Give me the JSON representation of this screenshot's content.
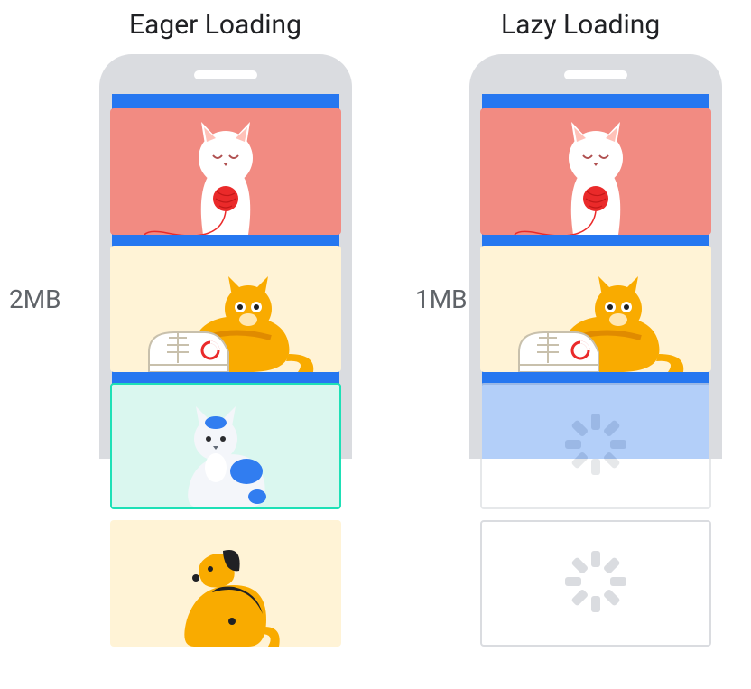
{
  "headings": {
    "eager": "Eager Loading",
    "lazy": "Lazy Loading"
  },
  "labels": {
    "eager_size": "2MB",
    "lazy_size": "1MB"
  },
  "colors": {
    "phone_chrome": "#dadce0",
    "screen": "#2677f0",
    "card_pink": "#f28b82",
    "card_cream": "#fff3d6",
    "highlight_border": "#1ee0b6",
    "text_heading": "#202124",
    "text_label": "#5f6368"
  },
  "eager_panel": {
    "loaded_size": "2MB",
    "cards": [
      {
        "id": "cat_yarn",
        "state": "loaded",
        "desc": "white cat playing with red yarn ball, pink background"
      },
      {
        "id": "cat_shoe",
        "state": "loaded",
        "desc": "orange cat lying behind a white sneaker, cream background"
      },
      {
        "id": "cat_spotted",
        "state": "loaded",
        "desc": "white cat with blue spots sitting, highlighted card partially below fold"
      },
      {
        "id": "dog_sitting",
        "state": "loaded",
        "desc": "orange dog with black markings sitting, cream background, fully below fold"
      }
    ]
  },
  "lazy_panel": {
    "loaded_size": "1MB",
    "cards": [
      {
        "id": "cat_yarn",
        "state": "loaded",
        "desc": "white cat playing with red yarn ball, pink background"
      },
      {
        "id": "cat_shoe",
        "state": "loaded",
        "desc": "orange cat lying behind a white sneaker, cream background"
      },
      {
        "id": "placeholder1",
        "state": "placeholder",
        "desc": "loading spinner placeholder, partially below fold"
      },
      {
        "id": "placeholder2",
        "state": "placeholder",
        "desc": "loading spinner placeholder, fully below fold"
      }
    ]
  },
  "icons": {
    "spinner": "loading-spinner-icon",
    "cat_yarn": "cat-yarn-icon",
    "cat_shoe": "cat-shoe-icon",
    "cat_spotted": "cat-spotted-icon",
    "dog_sitting": "dog-sitting-icon"
  }
}
